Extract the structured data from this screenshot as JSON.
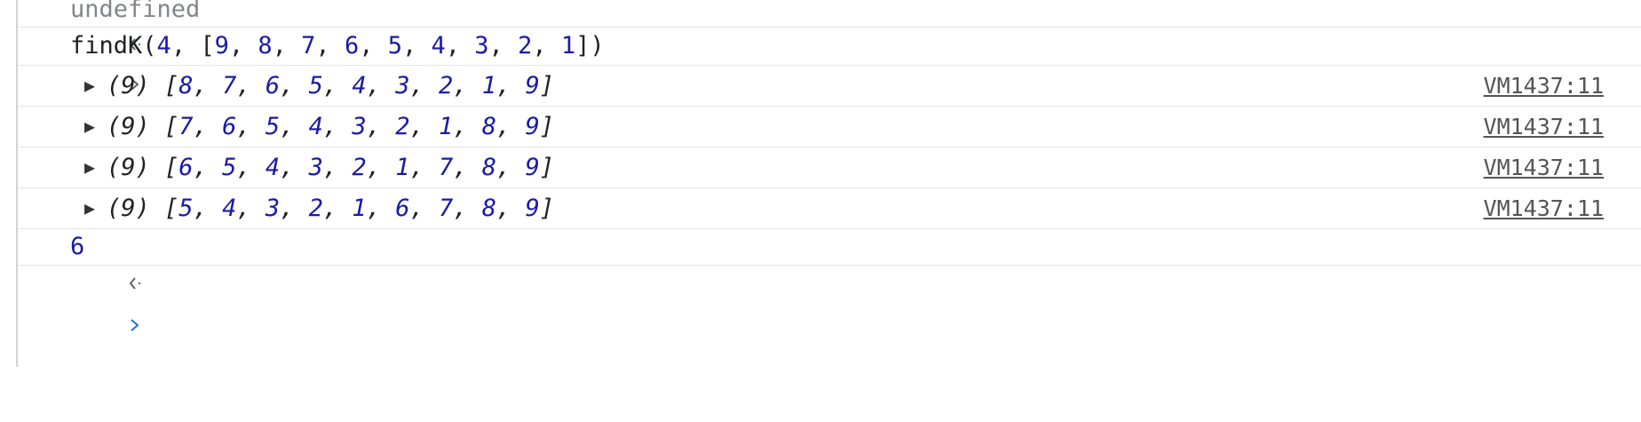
{
  "rows": [
    {
      "type": "return",
      "value": "undefined"
    },
    {
      "type": "input",
      "call": "findK",
      "args": {
        "k": "4",
        "array": [
          "9",
          "8",
          "7",
          "6",
          "5",
          "4",
          "3",
          "2",
          "1"
        ]
      }
    },
    {
      "type": "log",
      "count": "(9)",
      "values": [
        "8",
        "7",
        "6",
        "5",
        "4",
        "3",
        "2",
        "1",
        "9"
      ],
      "source": "VM1437:11"
    },
    {
      "type": "log",
      "count": "(9)",
      "values": [
        "7",
        "6",
        "5",
        "4",
        "3",
        "2",
        "1",
        "8",
        "9"
      ],
      "source": "VM1437:11"
    },
    {
      "type": "log",
      "count": "(9)",
      "values": [
        "6",
        "5",
        "4",
        "3",
        "2",
        "1",
        "7",
        "8",
        "9"
      ],
      "source": "VM1437:11"
    },
    {
      "type": "log",
      "count": "(9)",
      "values": [
        "5",
        "4",
        "3",
        "2",
        "1",
        "6",
        "7",
        "8",
        "9"
      ],
      "source": "VM1437:11"
    },
    {
      "type": "return",
      "value": "6"
    }
  ],
  "colors": {
    "number": "#1a1aa6",
    "text": "#202124",
    "muted": "#80868b",
    "prompt": "#1a73e8",
    "divider": "#e4e4e4"
  },
  "icons": {
    "return": "return-arrow-icon",
    "input": "chevron-right-icon",
    "expand": "expand-triangle-icon",
    "prompt": "prompt-chevron-icon"
  }
}
